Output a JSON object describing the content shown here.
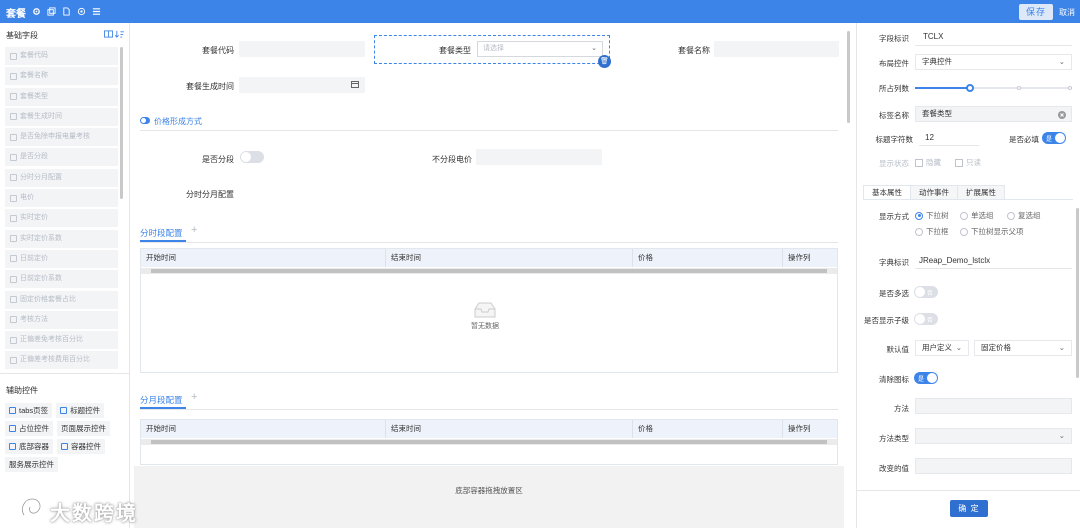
{
  "topbar": {
    "title": "套餐",
    "save": "保存",
    "cancel": "取消"
  },
  "left": {
    "base_title": "基础字段",
    "fields": [
      "套餐代码",
      "套餐名称",
      "套餐类型",
      "套餐生成时间",
      "是否免除申报电量考核",
      "是否分段",
      "分时分月配置",
      "电价",
      "实时定价",
      "实时定价系数",
      "日前定价",
      "日前定价系数",
      "固定价格套餐占比",
      "考核方法",
      "正偏差免考核百分比",
      "正偏差考核费用百分比"
    ],
    "aux_title": "辅助控件",
    "aux": [
      "tabs页签",
      "标题控件",
      "占位控件",
      "页面展示控件",
      "底部容器",
      "容器控件",
      "服务展示控件"
    ],
    "watermark": "大数跨境"
  },
  "center": {
    "code_label": "套餐代码",
    "type_label": "套餐类型",
    "type_placeholder": "请选择",
    "name_label": "套餐名称",
    "time_label": "套餐生成时间",
    "section_title": "价格形成方式",
    "segment_label": "是否分段",
    "nonseg_label": "不分段电价",
    "config_label": "分时分月配置",
    "tab1": "分时段配置",
    "tab2": "分月段配置",
    "columns": [
      "开始时间",
      "结束时间",
      "价格",
      "操作列"
    ],
    "empty": "暂无数据",
    "dropzone": "底部容器拖拽放置区"
  },
  "right": {
    "field_id_label": "字段标识",
    "field_id": "TCLX",
    "layout_label": "布局控件",
    "layout_value": "字典控件",
    "cols_label": "所占列数",
    "tag_label": "标签名称",
    "tag_value": "套餐类型",
    "title_chars_label": "标题字符数",
    "title_chars": "12",
    "required_label": "是否必填",
    "required_on": "是",
    "display_label": "显示状态",
    "hidden": "隐藏",
    "readonly": "只读",
    "tabs": [
      "基本属性",
      "动作事件",
      "扩展属性"
    ],
    "display_mode_label": "显示方式",
    "modes": [
      "下拉树",
      "单选组",
      "复选组",
      "下拉框",
      "下拉树显示父项"
    ],
    "dict_label": "字典标识",
    "dict_value": "JReap_Demo_lstclx",
    "multi_label": "是否多选",
    "multi_off": "否",
    "child_label": "是否显示子级",
    "child_off": "否",
    "default_label": "默认值",
    "default_type": "用户定义",
    "default_value": "固定价格",
    "clear_label": "清除图标",
    "clear_on": "是",
    "method_label": "方法",
    "method_type_label": "方法类型",
    "change_label": "改变的值",
    "confirm": "确 定"
  },
  "colors": {
    "accent": "#3d84e8",
    "topbar": "#3d84e8",
    "field_bg": "#f3f4f6",
    "header_bg": "#eef2fa"
  }
}
